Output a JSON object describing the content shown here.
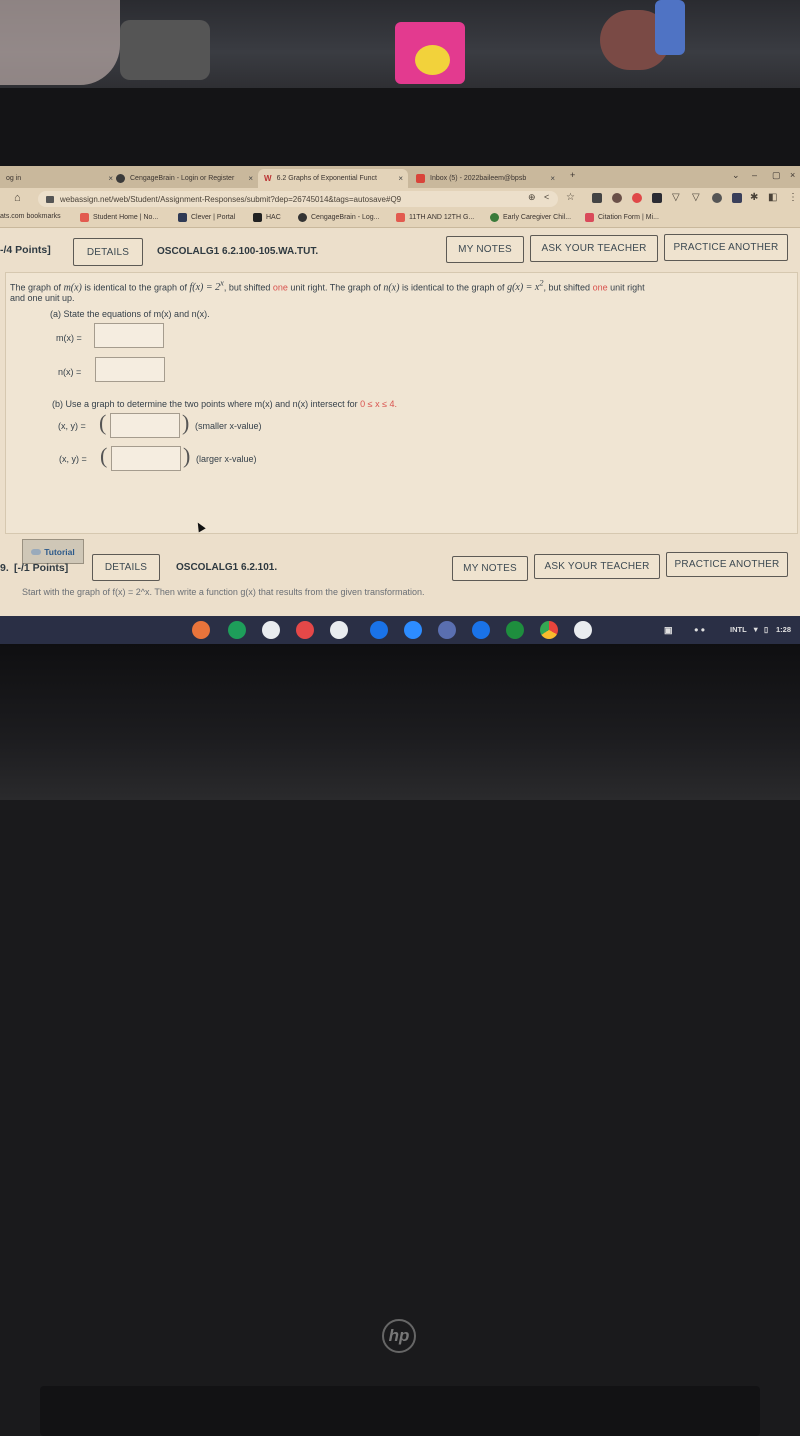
{
  "browser": {
    "tabs": [
      {
        "label": "og in",
        "icon": "generic-icon"
      },
      {
        "label": "CengageBrain - Login or Register",
        "icon": "globe-icon"
      },
      {
        "label": "6.2 Graphs of Exponential Funct",
        "icon": "webassign-icon",
        "active": true
      },
      {
        "label": "Inbox (5) - 2022baileem@bpsb",
        "icon": "mail-icon"
      }
    ],
    "new_tab_label": "+",
    "url": "webassign.net/web/Student/Assignment-Responses/submit?dep=26745014&tags=autosave#Q9",
    "bookmarks": [
      {
        "label": "ats.com bookmarks",
        "color": "#e3d3b9"
      },
      {
        "label": "Student Home | No...",
        "color": "#e25a4f"
      },
      {
        "label": "Clever | Portal",
        "color": "#2f3a55"
      },
      {
        "label": "HAC",
        "color": "#222"
      },
      {
        "label": "CengageBrain - Log...",
        "color": "#333"
      },
      {
        "label": "11TH AND 12TH G...",
        "color": "#e25a4f"
      },
      {
        "label": "Early Caregiver Chil...",
        "color": "#3a7a3a"
      },
      {
        "label": "Citation Form | Mi...",
        "color": "#d94a5a"
      }
    ]
  },
  "question1": {
    "points": "-/4 Points]",
    "details_label": "DETAILS",
    "code": "OSCOLALG1 6.2.100-105.WA.TUT.",
    "my_notes_label": "MY NOTES",
    "ask_teacher_label": "ASK YOUR TEACHER",
    "practice_label": "PRACTICE ANOTHER",
    "prompt_line1_a": "The graph of",
    "m": "m(x)",
    "prompt_line1_b": "is identical to the graph of",
    "f": "f(x) = 2",
    "f_exp": "x",
    "prompt_line1_c": ", but shifted",
    "one": "one",
    "prompt_line1_d": "unit right. The graph of",
    "n": "n(x)",
    "prompt_line1_e": "is identical to the graph of",
    "g": "g(x) = x",
    "g_exp": "2",
    "prompt_line1_f": ", but shifted",
    "prompt_line1_g": "unit right",
    "prompt_line2": "and one unit up.",
    "part_a": "(a) State the equations of m(x) and n(x).",
    "m_label": "m(x) =",
    "n_label": "n(x) =",
    "m_value": "",
    "n_value": "",
    "part_b": "(b) Use a graph to determine the two points where m(x) and n(x) intersect for",
    "part_b_range": "0 ≤ x ≤ 4.",
    "xy_label": "(x, y) =",
    "smaller_label": "(smaller x-value)",
    "larger_label": "(larger x-value)",
    "smaller_value": "",
    "larger_value": "",
    "tutorial_label": "Tutorial"
  },
  "question2": {
    "points": "[-/1 Points]",
    "number_prefix": "9.",
    "details_label": "DETAILS",
    "code": "OSCOLALG1 6.2.101.",
    "my_notes_label": "MY NOTES",
    "ask_teacher_label": "ASK YOUR TEACHER",
    "practice_label": "PRACTICE ANOTHER",
    "prompt": "Start with the graph of f(x) = 2^x. Then write a function g(x) that results from the given transformation."
  },
  "shelf": {
    "apps": [
      {
        "name": "firefox-icon",
        "color": "#e8743b"
      },
      {
        "name": "hangouts-icon",
        "color": "#1e9e5a"
      },
      {
        "name": "phone-icon",
        "color": "#2eaa55"
      },
      {
        "name": "record-icon",
        "color": "#e54848"
      },
      {
        "name": "calculator-icon",
        "color": "#6b6f7a"
      },
      {
        "name": "meet-icon",
        "color": "#1a73e8"
      },
      {
        "name": "zoom-icon",
        "color": "#2d8cff"
      },
      {
        "name": "classroom-app-icon",
        "color": "#5a6fb0"
      },
      {
        "name": "camera-icon",
        "color": "#1a73e8"
      },
      {
        "name": "google-classroom-icon",
        "color": "#1e8e3e"
      },
      {
        "name": "chrome-icon",
        "color": "#e8453c"
      },
      {
        "name": "play-store-icon",
        "color": "#34a853"
      }
    ],
    "keyboard_layout": "INTL",
    "time": "1:28"
  },
  "laptop_brand": "hp"
}
